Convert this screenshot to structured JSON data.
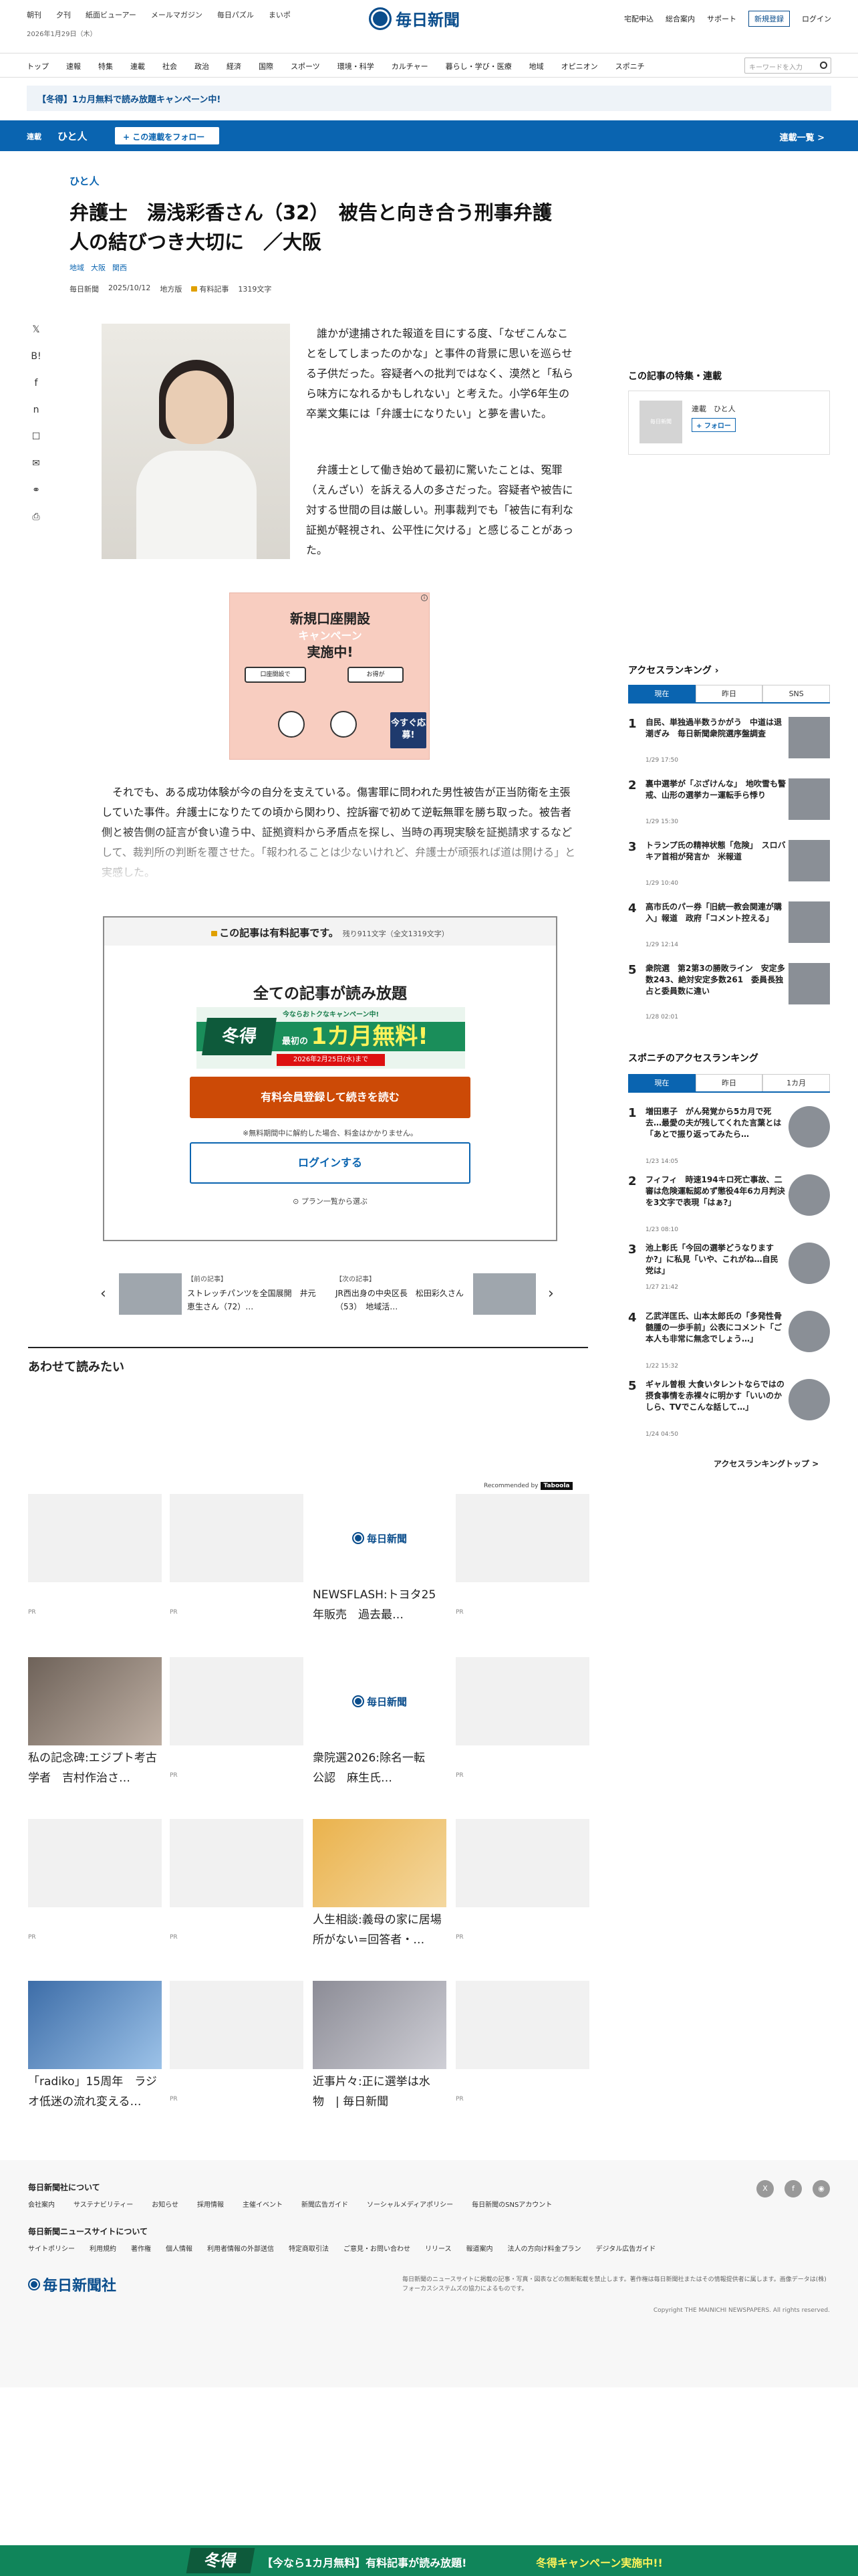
{
  "header": {
    "top_links": [
      "朝刊",
      "夕刊",
      "紙面ビューアー",
      "メールマガジン",
      "毎日パズル",
      "まいポ"
    ],
    "date": "2026年1月29日（木）",
    "logo": "毎日新聞",
    "right_links": [
      "宅配申込",
      "総合案内",
      "サポート"
    ],
    "register": "新規登録",
    "login": "ログイン"
  },
  "nav": {
    "items": [
      "トップ",
      "速報",
      "特集",
      "連載",
      "社会",
      "政治",
      "経済",
      "国際",
      "スポーツ",
      "環境・科学",
      "カルチャー",
      "暮らし・学び・医療",
      "地域",
      "オピニオン",
      "スポニチ"
    ],
    "search_placeholder": "キーワードを入力"
  },
  "promo_strip": "【冬得】1カ月無料で読み放題キャンペーン中!",
  "series_bar": {
    "label": "連載",
    "name": "ひと人",
    "follow": "+ この連載をフォロー",
    "list": "連載一覧 >"
  },
  "article": {
    "kicker": "ひと人",
    "headline": "弁護士　湯浅彩香さん（32）　被告と向き合う刑事弁護　人の結びつき大切に　／大阪",
    "tags": [
      "地域",
      "大阪",
      "関西"
    ],
    "meta": {
      "source": "毎日新聞",
      "date": "2025/10/12",
      "edition": "地方版",
      "paid": "有料記事",
      "chars": "1319文字"
    },
    "p1": "誰かが逮捕された報道を目にする度、「なぜこんなことをしてしまったのかな」と事件の背景に思いを巡らせる子供だった。容疑者への批判ではなく、漠然と「私らら味方になれるかもしれない」と考えた。小学6年生の卒業文集には「弁護士になりたい」と夢を書いた。",
    "p2": "弁護士として働き始めて最初に驚いたことは、冤罪（えんざい）を訴える人の多さだった。容疑者や被告に対する世間の目は厳しい。刑事裁判でも「被告に有利な証拠が軽視され、公平性に欠ける」と感じることがあった。",
    "p3": "それでも、ある成功体験が今の自分を支えている。傷害罪に問われた男性被告が正当防衛を主張していた事件。弁護士になりたての頃から関わり、控訴審で初めて逆転無罪を勝ち取った。被告者側と被告側の証言が食い違う中、証拠資料から矛盾点を探し、当時の再現実験を証拠請求するなどして、裁判所の判断を覆させた。「報われることは少ないけれど、弁護士が頑張れば道は開ける」と実感した。"
  },
  "ad": {
    "t1": "新規口座開設",
    "t2": "キャンペーン",
    "t3": "実施中!",
    "b1": "口座開設で",
    "b2": "お得が",
    "apply": "今すぐ応募!"
  },
  "paywall": {
    "head": "この記事は有料記事です。",
    "rest": "残り911文字（全文1319文字）",
    "title": "全ての記事が読み放題",
    "banner_small": "今ならおトクなキャンペーン中!",
    "fuyu": "冬得",
    "banner_big_pre": "最初の",
    "banner_big": "1カ月無料!",
    "deadline": "2026年2月25日(水)まで",
    "cta": "有料会員登録して続きを読む",
    "note": "※無料期間中に解約した場合、料金はかかりません。",
    "login": "ログインする",
    "plan": "プラン一覧から選ぶ"
  },
  "prevnext": {
    "prev_kicker": "【前の記事】",
    "prev_text": "ストレッチパンツを全国展開　井元恵生さん（72）…",
    "next_kicker": "【次の記事】",
    "next_text": "JR西出身の中央区長　松田彩久さん（53）　地域活…"
  },
  "together": "あわせて読みたい",
  "recommended": "Recommended by",
  "taboola": "Taboola",
  "tiles": [
    {
      "caption": "",
      "pr": "PR"
    },
    {
      "caption": "",
      "pr": "PR"
    },
    {
      "caption": "NEWSFLASH:トヨタ25年販売　過去最…",
      "pr": ""
    },
    {
      "caption": "",
      "pr": "PR"
    },
    {
      "caption": "私の記念碑:エジプト考古学者　吉村作治さ…",
      "pr": ""
    },
    {
      "caption": "",
      "pr": "PR"
    },
    {
      "caption": "衆院選2026:除名一転　公認　麻生氏…",
      "pr": ""
    },
    {
      "caption": "",
      "pr": "PR"
    },
    {
      "caption": "",
      "pr": "PR"
    },
    {
      "caption": "",
      "pr": "PR"
    },
    {
      "caption": "人生相談:義母の家に居場所がない=回答者・…",
      "pr": ""
    },
    {
      "caption": "",
      "pr": "PR"
    },
    {
      "caption": "「radiko」15周年　ラジオ低迷の流れ変える…",
      "pr": ""
    },
    {
      "caption": "",
      "pr": "PR"
    },
    {
      "caption": "近事片々:正に選挙は水物　| 毎日新聞",
      "pr": ""
    },
    {
      "caption": "",
      "pr": "PR"
    }
  ],
  "sidebar": {
    "feature_title": "この記事の特集・連載",
    "feature_label": "連載",
    "feature_name": "ひと人",
    "feature_follow": "+ フォロー",
    "feature_thumb": "毎日新聞",
    "ranking_title": "アクセスランキング",
    "tabs": [
      "現在",
      "昨日",
      "SNS"
    ],
    "ranking": [
      {
        "n": "1",
        "t": "自民、単独過半数うかがう　中道は退潮ぎみ　毎日新聞衆院選序盤調査",
        "d": "1/29 17:50"
      },
      {
        "n": "2",
        "t": "裏中選挙が「ぶざけんな」　地吹雪も警戒、山形の選挙カー運転手ら悸り",
        "d": "1/29 15:30"
      },
      {
        "n": "3",
        "t": "トランプ氏の精神状態「危険」　スロバキア首相が発言か　米報道",
        "d": "1/29 10:40"
      },
      {
        "n": "4",
        "t": "高市氏のパー券「旧統一教会関連が購入」報道　政府「コメント控える」",
        "d": "1/29 12:14"
      },
      {
        "n": "5",
        "t": "衆院選　第2第3の勝敗ライン　安定多数243、絶対安定多数261　委員長独占と委員数に違い",
        "d": "1/28 02:01"
      }
    ],
    "sponichi_title": "スポニチのアクセスランキング",
    "sponichi_tabs": [
      "現在",
      "昨日",
      "1カ月"
    ],
    "sponichi": [
      {
        "n": "1",
        "t": "増田恵子　がん発覚から5カ月で死去…最愛の夫が残してくれた言葉とは「あとで振り返ってみたら…",
        "d": "1/23 14:05"
      },
      {
        "n": "2",
        "t": "フィフィ　時速194キロ死亡事故、二審は危険運転認めず懲役4年6カ月判決を3文字で表現「はぁ?」",
        "d": "1/23 08:10"
      },
      {
        "n": "3",
        "t": "池上彰氏「今回の選挙どうなりますか?」に私見「いや、これがね…自民党は」",
        "d": "1/27 21:42"
      },
      {
        "n": "4",
        "t": "乙武洋匡氏、山本太郎氏の「多発性骨髄腫の一歩手前」公表にコメント「ご本人も非常に無念でしょう…」",
        "d": "1/22 15:32"
      },
      {
        "n": "5",
        "t": "ギャル曽根 大食いタレントならではの摂食事情を赤裸々に明かす「いいのかしら、TVでこんな話して…」",
        "d": "1/24 04:50"
      }
    ],
    "ranking_top": "アクセスランキングトップ >"
  },
  "footer": {
    "about": "毎日新聞社について",
    "about_links": [
      "会社案内",
      "サステナビリティー",
      "お知らせ",
      "採用情報",
      "主催イベント",
      "新聞広告ガイド",
      "ソーシャルメディアポリシー",
      "毎日新聞のSNSアカウント"
    ],
    "site": "毎日新聞ニュースサイトについて",
    "site_links": [
      "サイトポリシー",
      "利用規約",
      "著作権",
      "個人情報",
      "利用者情報の外部送信",
      "特定商取引法",
      "ご意見・お問い合わせ",
      "リリース",
      "報道案内",
      "法人の方向け料金プラン",
      "デジタル広告ガイド"
    ],
    "social": [
      "X",
      "f",
      "◉"
    ],
    "logo": "毎日新聞社",
    "note": "毎日新聞のニュースサイトに掲載の記事・写真・図表などの無断転載を禁止します。著作権は毎日新聞社またはその情報提供者に属します。画像データは(株)フォーカスシステムズの協力によるものです。",
    "copy": "Copyright THE MAINICHI NEWSPAPERS. All rights reserved."
  },
  "bottom_bar": {
    "fuyu": "冬得",
    "msg": "【今なら1カ月無料】有料記事が読み放題!",
    "tag": "冬得キャンペーン実施中!!"
  },
  "colors": {
    "brand": "#0a4d8c",
    "accent_blue": "#0a64b0",
    "cta_orange": "#cc4a06",
    "promo_green": "#10855a"
  }
}
